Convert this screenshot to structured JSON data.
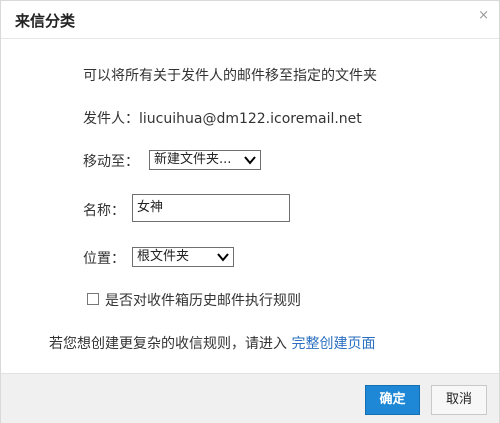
{
  "dialog": {
    "title": "来信分类",
    "close_icon": "×"
  },
  "description": "可以将所有关于发件人的邮件移至指定的文件夹",
  "sender": {
    "label": "发件人：",
    "value": "liucuihua@dm122.icoremail.net"
  },
  "move_to": {
    "label": "移动至：",
    "selected": "新建文件夹..."
  },
  "name": {
    "label": "名称：",
    "value": "女神"
  },
  "location": {
    "label": "位置：",
    "selected": "根文件夹"
  },
  "history_rule": {
    "label": "是否对收件箱历史邮件执行规则",
    "checked": false
  },
  "advanced": {
    "text": "若您想创建更复杂的收信规则，请进入",
    "link": "完整创建页面"
  },
  "buttons": {
    "confirm": "确定",
    "cancel": "取消"
  },
  "colors": {
    "primary_button": "#1e88d6",
    "link": "#2a6fc1",
    "footer_bg": "#f0f0f0"
  }
}
